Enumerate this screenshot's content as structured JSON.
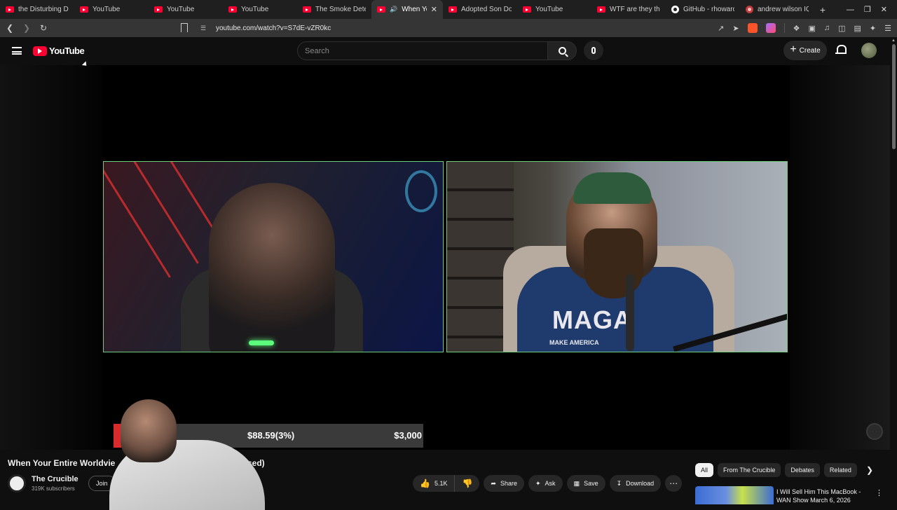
{
  "browser": {
    "tabs": [
      {
        "label": "the Disturbing De",
        "icon": "youtube-favicon",
        "active": false
      },
      {
        "label": "YouTube",
        "icon": "youtube-favicon",
        "active": false
      },
      {
        "label": "YouTube",
        "icon": "youtube-favicon",
        "active": false
      },
      {
        "label": "YouTube",
        "icon": "youtube-favicon",
        "active": false
      },
      {
        "label": "The Smoke Detec",
        "icon": "youtube-favicon",
        "active": false
      },
      {
        "label": "When Your",
        "icon": "youtube-favicon",
        "active": true,
        "audio": true
      },
      {
        "label": "Adopted Son Doe",
        "icon": "youtube-favicon",
        "active": false
      },
      {
        "label": "YouTube",
        "icon": "youtube-favicon",
        "active": false
      },
      {
        "label": "WTF are they thin",
        "icon": "youtube-favicon",
        "active": false
      },
      {
        "label": "GitHub - rhoward",
        "icon": "github-favicon",
        "active": false
      },
      {
        "label": "andrew wilson IQ",
        "icon": "site-favicon",
        "active": false
      }
    ],
    "new_tab": "+",
    "url": "youtube.com/watch?v=S7dE-vZR0kc"
  },
  "header": {
    "logo_text": "YouTube",
    "search_placeholder": "Search",
    "create_label": "Create"
  },
  "player": {
    "donation": {
      "raised": "$88.59(3%)",
      "goal": "$3,000",
      "progress_percent": 3
    },
    "overlay_shirt_text": "MAGA",
    "overlay_shirt_subtext": "MAKE AMERICA"
  },
  "video": {
    "title_start": "When Your Entire Worldvie",
    "title_end": "ut Exposed)",
    "channel_name": "The Crucible",
    "subscribers": "319K subscribers",
    "join_label": "Join",
    "like_count": "5.1K",
    "share_label": "Share",
    "ask_label": "Ask",
    "save_label": "Save",
    "download_label": "Download"
  },
  "sidebar": {
    "chips": [
      "All",
      "From The Crucible",
      "Debates",
      "Related"
    ],
    "recommended": [
      {
        "title": "I Will Sell Him This MacBook - WAN Show March 6, 2026"
      }
    ]
  },
  "colors": {
    "accent": "#ff0033",
    "feed_border": "#6dcf7c",
    "donation_fill": "#d92b2b"
  }
}
